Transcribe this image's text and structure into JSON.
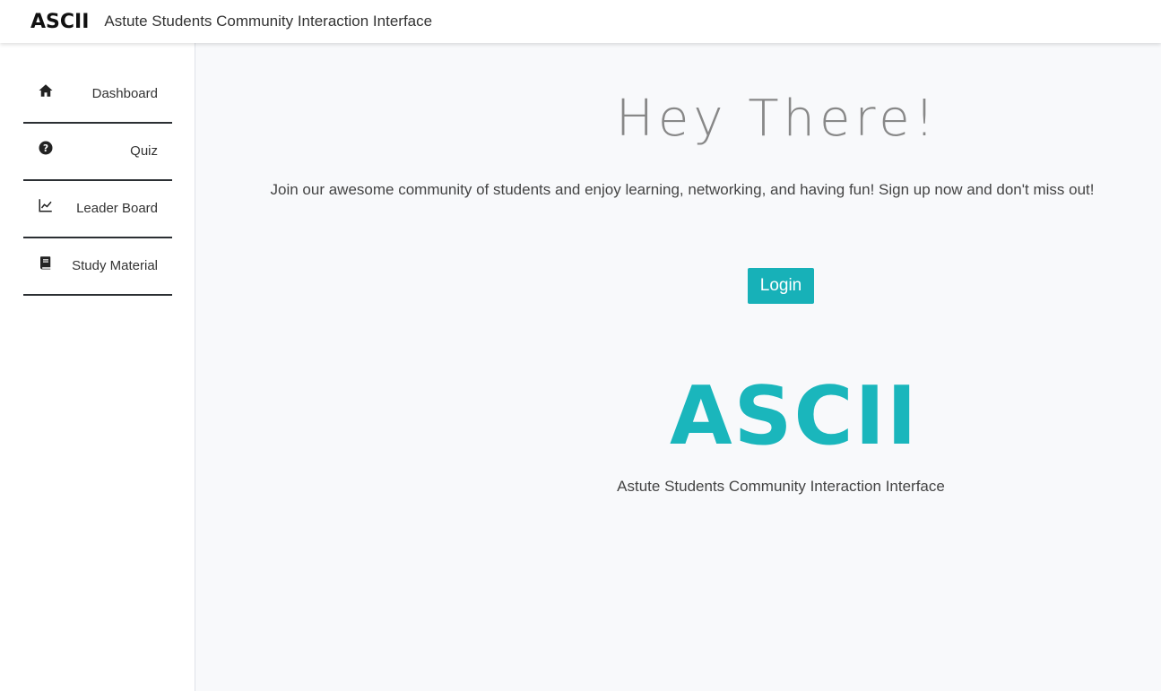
{
  "header": {
    "brand": "ASCII",
    "subtitle": "Astute Students Community Interaction Interface"
  },
  "sidebar": {
    "items": [
      {
        "label": "Dashboard",
        "icon": "home-icon"
      },
      {
        "label": "Quiz",
        "icon": "question-circle-icon"
      },
      {
        "label": "Leader Board",
        "icon": "line-chart-icon"
      },
      {
        "label": "Study Material",
        "icon": "book-icon"
      }
    ]
  },
  "main": {
    "heading": "Hey There!",
    "description": "Join our awesome community of students and enjoy learning, networking, and having fun! Sign up now and don't miss out!",
    "login_label": "Login",
    "logo_text": "ASCII",
    "logo_subtitle": "Astute Students Community Interaction Interface"
  },
  "colors": {
    "accent": "#17b1b8",
    "logo": "#1ab6bc",
    "heading": "#888888"
  }
}
